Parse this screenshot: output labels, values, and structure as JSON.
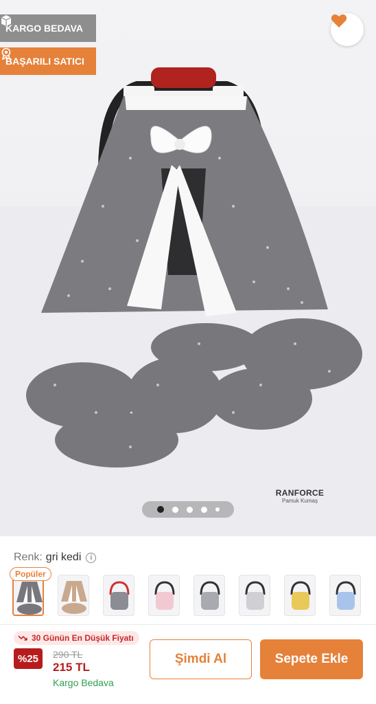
{
  "badges": {
    "kargo": "KARGO BEDAVA",
    "satici": "BAŞARILI SATICI"
  },
  "icons": {
    "favorite": "heart-icon",
    "kargo": "box-icon",
    "satici": "award-icon",
    "info": "info-icon",
    "trend": "trend-down-icon"
  },
  "brand_label": {
    "title": "RANFORCE",
    "subtitle": "Pamuk Kumaş"
  },
  "gallery": {
    "slide_count": 5,
    "active_slide": 1
  },
  "variant": {
    "label": "Renk:",
    "value": "gri kedi",
    "info_glyph": "i",
    "popular_label": "Popüler",
    "thumbnails": [
      "grey",
      "beige",
      "grey",
      "pink",
      "grey",
      "grey",
      "yellow",
      "blue"
    ]
  },
  "price": {
    "lowest_label": "30 Günün En Düşük Fiyatı",
    "discount": "%25",
    "old": "290 TL",
    "new": "215 TL",
    "shipping": "Kargo Bedava"
  },
  "actions": {
    "buy_now": "Şimdi Al",
    "add_to_cart": "Sepete Ekle"
  },
  "colors": {
    "accent": "#e6813a",
    "price_red": "#b71c1c",
    "shipping_green": "#2e9e4f",
    "badge_grey": "#8e8e8e"
  }
}
